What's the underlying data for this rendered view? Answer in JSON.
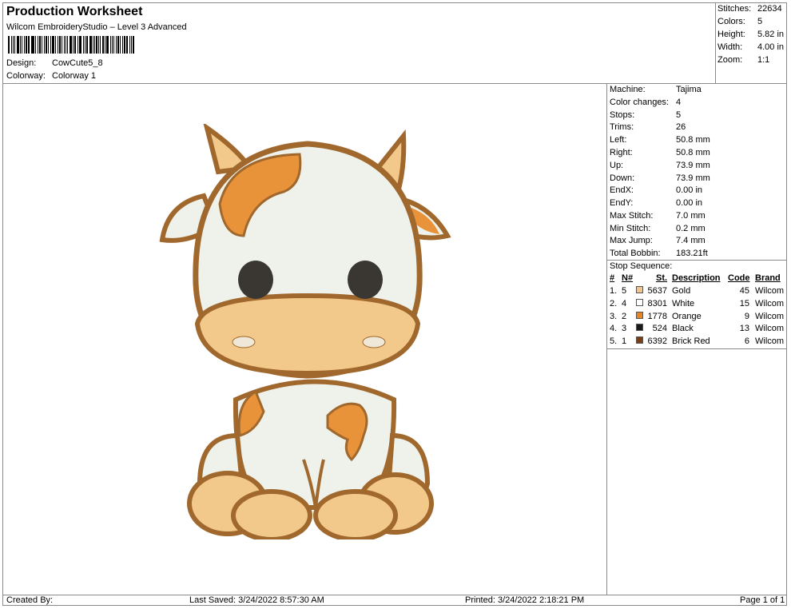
{
  "header": {
    "title": "Production Worksheet",
    "subtitle": "Wilcom EmbroideryStudio – Level 3 Advanced",
    "design_label": "Design:",
    "design_value": "CowCute5_8",
    "colorway_label": "Colorway:",
    "colorway_value": "Colorway 1"
  },
  "stats": [
    {
      "label": "Stitches:",
      "value": "22634"
    },
    {
      "label": "Colors:",
      "value": "5"
    },
    {
      "label": "Height:",
      "value": "5.82 in"
    },
    {
      "label": "Width:",
      "value": "4.00 in"
    },
    {
      "label": "Zoom:",
      "value": "1:1"
    }
  ],
  "machine_info": [
    {
      "label": "Machine:",
      "value": "Tajima"
    },
    {
      "label": "Color changes:",
      "value": "4"
    },
    {
      "label": "Stops:",
      "value": "5"
    },
    {
      "label": "Trims:",
      "value": "26"
    },
    {
      "label": "Left:",
      "value": "50.8 mm"
    },
    {
      "label": "Right:",
      "value": "50.8 mm"
    },
    {
      "label": "Up:",
      "value": "73.9 mm"
    },
    {
      "label": "Down:",
      "value": "73.9 mm"
    },
    {
      "label": "EndX:",
      "value": "0.00 in"
    },
    {
      "label": "EndY:",
      "value": "0.00 in"
    },
    {
      "label": "Max Stitch:",
      "value": "7.0 mm"
    },
    {
      "label": "Min Stitch:",
      "value": "0.2 mm"
    },
    {
      "label": "Max Jump:",
      "value": "7.4 mm"
    },
    {
      "label": "Total Bobbin:",
      "value": "183.21ft"
    }
  ],
  "stop_sequence": {
    "title": "Stop Sequence:",
    "columns": [
      "#",
      "N#",
      "St.",
      "Description",
      "Code",
      "Brand"
    ],
    "rows": [
      {
        "num": "1.",
        "n": "5",
        "color": "#f5c48a",
        "st": "5637",
        "description": "Gold",
        "code": "45",
        "brand": "Wilcom"
      },
      {
        "num": "2.",
        "n": "4",
        "color": "#ffffff",
        "st": "8301",
        "description": "White",
        "code": "15",
        "brand": "Wilcom"
      },
      {
        "num": "3.",
        "n": "2",
        "color": "#e8841e",
        "st": "1778",
        "description": "Orange",
        "code": "9",
        "brand": "Wilcom"
      },
      {
        "num": "4.",
        "n": "3",
        "color": "#1a1a1a",
        "st": "524",
        "description": "Black",
        "code": "13",
        "brand": "Wilcom"
      },
      {
        "num": "5.",
        "n": "1",
        "color": "#7a3e10",
        "st": "6392",
        "description": "Brick Red",
        "code": "6",
        "brand": "Wilcom"
      }
    ]
  },
  "footer": {
    "created_by": "Created By:",
    "last_saved": "Last Saved: 3/24/2022 8:57:30 AM",
    "printed": "Printed: 3/24/2022 2:18:21 PM",
    "page": "Page 1 of 1"
  },
  "design_preview": {
    "subject": "cow",
    "colors": {
      "outline": "#a0682c",
      "white": "#eef2ea",
      "orange": "#e8923a",
      "gold": "#f2c98a",
      "eye": "#3a3631"
    }
  }
}
